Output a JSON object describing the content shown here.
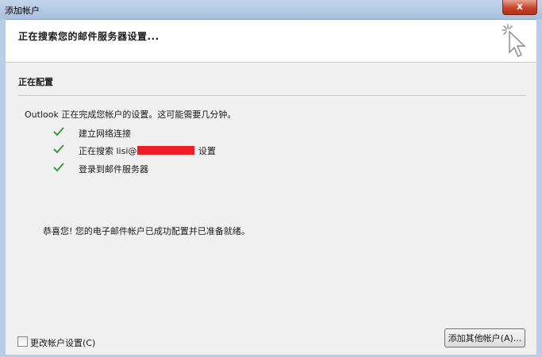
{
  "window": {
    "title": "添加帐户",
    "close_label": "x"
  },
  "header": {
    "heading": "正在搜索您的邮件服务器设置..."
  },
  "section": {
    "title": "正在配置",
    "intro": "Outlook 正在完成您帐户的设置。这可能需要几分钟。",
    "steps": [
      {
        "text": "建立网络连接",
        "status": "done"
      },
      {
        "text_prefix": "正在搜索 lisi@",
        "text_suffix": " 设置",
        "status": "done"
      },
      {
        "text": "登录到邮件服务器",
        "status": "done"
      }
    ],
    "success": "恭喜您! 您的电子邮件帐户已成功配置并已准备就绪。"
  },
  "footer": {
    "change_settings_label": "更改帐户设置(C)",
    "change_settings_checked": false,
    "add_other_label": "添加其他帐户(A)..."
  },
  "colors": {
    "check": "#3e9a3e",
    "redaction": "#ee1c24",
    "titlebar": "#b8cce4"
  }
}
